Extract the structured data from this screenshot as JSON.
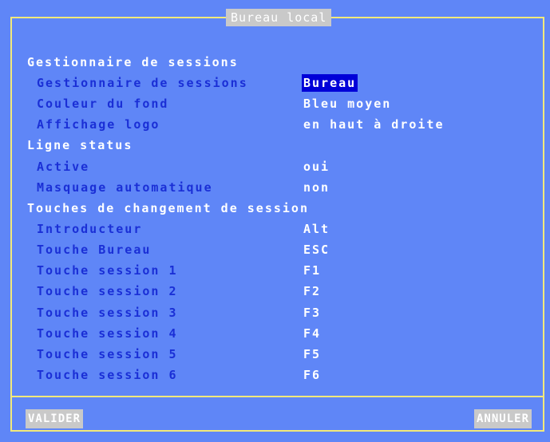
{
  "window": {
    "title": "Bureau local"
  },
  "sections": {
    "sessions": "Gestionnaire de sessions",
    "status": "Ligne status",
    "keys": "Touches de changement de session"
  },
  "rows": {
    "gestionnaire": {
      "label": "Gestionnaire de sessions",
      "value": "Bureau"
    },
    "couleur": {
      "label": "Couleur du fond",
      "value": "Bleu moyen"
    },
    "logo": {
      "label": "Affichage logo",
      "value": "en haut à droite"
    },
    "active": {
      "label": "Active",
      "value": "oui"
    },
    "masquage": {
      "label": "Masquage automatique",
      "value": "non"
    },
    "introducteur": {
      "label": "Introducteur",
      "value": "Alt"
    },
    "bureau": {
      "label": "Touche Bureau",
      "value": "ESC"
    },
    "s1": {
      "label": "Touche session 1",
      "value": "F1"
    },
    "s2": {
      "label": "Touche session 2",
      "value": "F2"
    },
    "s3": {
      "label": "Touche session 3",
      "value": "F3"
    },
    "s4": {
      "label": "Touche session 4",
      "value": "F4"
    },
    "s5": {
      "label": "Touche session 5",
      "value": "F5"
    },
    "s6": {
      "label": "Touche session 6",
      "value": "F6"
    }
  },
  "buttons": {
    "validate": "VALIDER",
    "cancel": "ANNULER"
  },
  "colors": {
    "background": "#5f86f7",
    "frame": "#f2e97a",
    "label": "#1a2fd6",
    "text": "#ffffff",
    "selection": "#0000d8",
    "button": "#c9c9c9"
  }
}
